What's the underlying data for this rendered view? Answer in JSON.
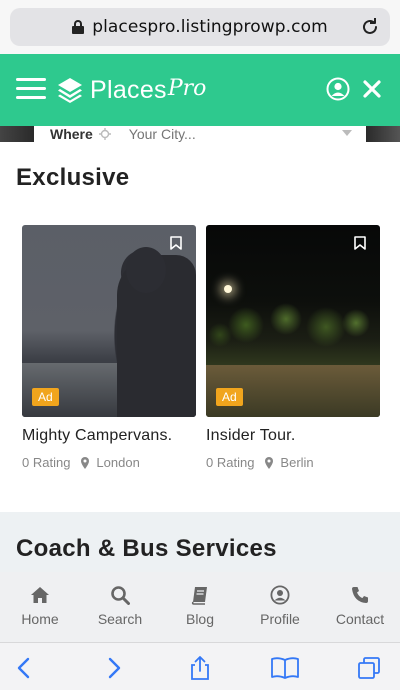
{
  "browser": {
    "url": "placespro.listingprowp.com",
    "icons": [
      "lock-icon",
      "reload-icon"
    ]
  },
  "header": {
    "logo_text": "Places",
    "logo_script": "Pro",
    "brand_color": "#2ec98e",
    "icons": [
      "hamburger-menu-icon",
      "user-icon",
      "close-icon"
    ]
  },
  "search": {
    "where_label": "Where",
    "city_placeholder": "Your City..."
  },
  "exclusive": {
    "title": "Exclusive",
    "cards": [
      {
        "title": "Mighty Campervans.",
        "rating": "0 Rating",
        "location": "London",
        "badge": "Ad"
      },
      {
        "title": "Insider Tour.",
        "rating": "0 Rating",
        "location": "Berlin",
        "badge": "Ad"
      }
    ],
    "badge_color": "#f1a51d"
  },
  "section2": {
    "title": "Coach & Bus Services"
  },
  "bottom_nav": [
    {
      "label": "Home",
      "icon": "home-icon"
    },
    {
      "label": "Search",
      "icon": "search-icon"
    },
    {
      "label": "Blog",
      "icon": "book-icon"
    },
    {
      "label": "Profile",
      "icon": "profile-icon"
    },
    {
      "label": "Contact",
      "icon": "phone-icon"
    }
  ],
  "safari_toolbar": {
    "accent_color": "#3478f6",
    "icons": [
      "back-icon",
      "forward-icon",
      "share-icon",
      "bookmarks-icon",
      "tabs-icon"
    ]
  }
}
